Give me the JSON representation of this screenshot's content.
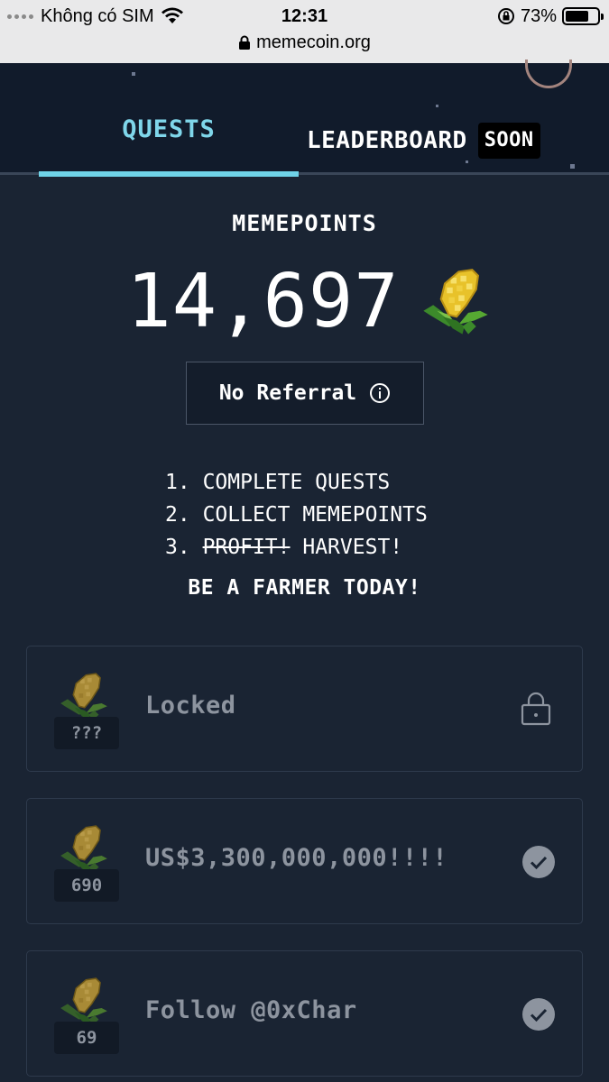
{
  "status_bar": {
    "carrier": "Không có SIM",
    "time": "12:31",
    "battery": "73%",
    "battery_level": 0.73,
    "url": "memecoin.org"
  },
  "nav": {
    "tabs": [
      {
        "label": "QUESTS",
        "active": true
      },
      {
        "label": "LEADERBOARD",
        "badge": "SOON",
        "active": false
      }
    ]
  },
  "points": {
    "label": "MEMEPOINTS",
    "value": "14,697",
    "icon": "corn-icon"
  },
  "referral": {
    "label": "No Referral",
    "icon": "info-icon"
  },
  "steps": [
    {
      "num": "1.",
      "text": "COMPLETE QUESTS"
    },
    {
      "num": "2.",
      "text": "COLLECT MEMEPOINTS"
    },
    {
      "num": "3.",
      "struck": "PROFIT!",
      "text": "HARVEST!"
    }
  ],
  "tagline": "BE A FARMER TODAY!",
  "quests": [
    {
      "reward": "???",
      "title": "Locked",
      "status_icon": "lock-icon"
    },
    {
      "reward": "690",
      "title": "US$3,300,000,000!!!!",
      "status_icon": "check-circle-icon"
    },
    {
      "reward": "69",
      "title": "Follow @0xChar",
      "status_icon": "check-circle-icon"
    }
  ],
  "colors": {
    "background": "#1a2433",
    "nav_background": "#111b2b",
    "accent": "#6fd3e8",
    "muted_text": "#8d949f"
  }
}
